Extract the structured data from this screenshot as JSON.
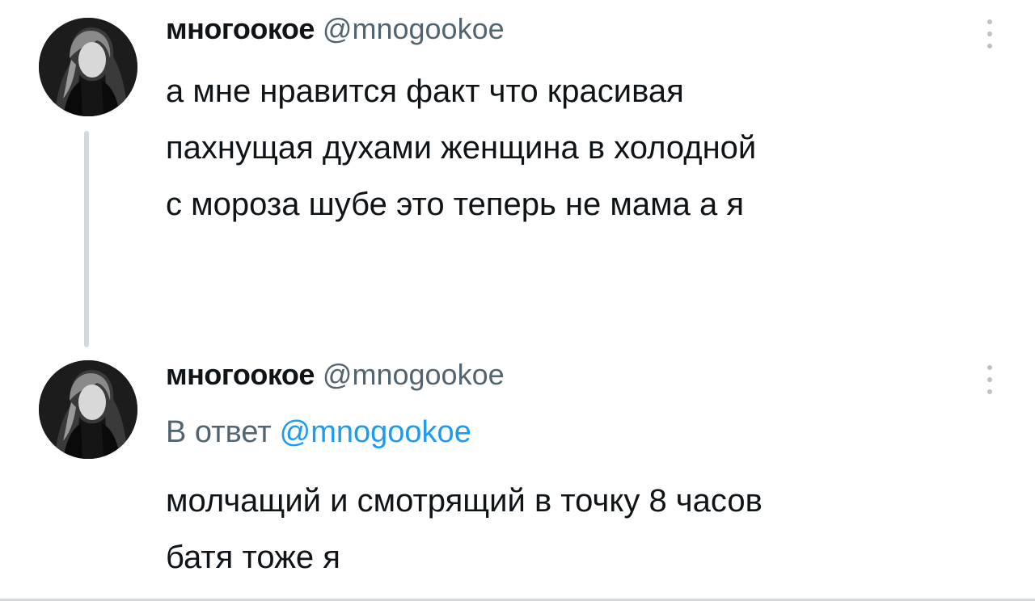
{
  "tweets": [
    {
      "author_name": "многоокое",
      "author_handle": "@mnogookoe",
      "avatar_icon": "profile-photo-icon",
      "text": "а мне нравится факт что красивая\nпахнущая духами женщина в холодной\nс мороза шубе это теперь не мама а я"
    },
    {
      "author_name": "многоокое",
      "author_handle": "@mnogookoe",
      "avatar_icon": "profile-photo-icon",
      "reply_prefix": "В ответ",
      "reply_to": "@mnogookoe",
      "text": "молчащий и смотрящий в точку 8 часов\nбатя тоже я"
    }
  ],
  "colors": {
    "text_primary": "#0f1419",
    "text_secondary": "#536471",
    "link": "#1d9bf0",
    "divider": "#cfd9de"
  },
  "icons": {
    "more": "more-dots-vertical-icon",
    "avatar": "profile-photo-icon"
  }
}
